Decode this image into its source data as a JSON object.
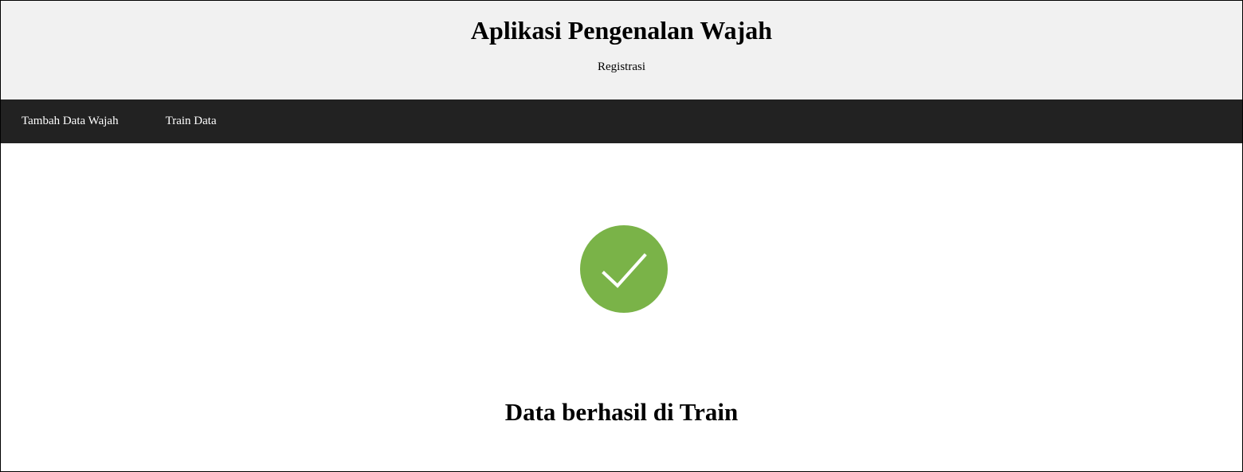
{
  "header": {
    "title": "Aplikasi Pengenalan Wajah",
    "subtitle": "Registrasi"
  },
  "nav": {
    "items": [
      {
        "label": "Tambah Data Wajah"
      },
      {
        "label": "Train Data"
      }
    ]
  },
  "main": {
    "icon": "checkmark-circle-icon",
    "icon_color": "#7ab348",
    "message": "Data berhasil di Train"
  },
  "colors": {
    "header_bg": "#f1f1f1",
    "nav_bg": "#222222",
    "nav_text": "#ffffff"
  }
}
